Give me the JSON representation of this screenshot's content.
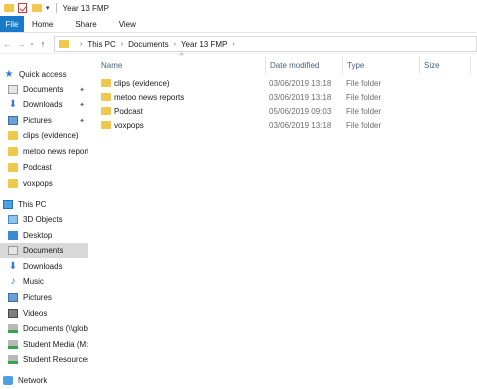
{
  "window": {
    "title": "Year 13 FMP",
    "qa_dropdown": "▾"
  },
  "ribbon": {
    "tabs": [
      "File",
      "Home",
      "Share",
      "View"
    ]
  },
  "nav": {
    "back": "←",
    "forward": "→",
    "recent": "⌄",
    "up": "↑",
    "breadcrumb": [
      "This PC",
      "Documents",
      "Year 13 FMP"
    ],
    "crumb_separator": "›"
  },
  "sidebar": {
    "items": [
      {
        "label": "Quick access",
        "icon": "star-icon"
      },
      {
        "label": "Documents",
        "icon": "documents-icon",
        "pinned": true
      },
      {
        "label": "Downloads",
        "icon": "downloads-icon",
        "pinned": true
      },
      {
        "label": "Pictures",
        "icon": "pictures-icon",
        "pinned": true
      },
      {
        "label": "clips (evidence)",
        "icon": "folder-icon"
      },
      {
        "label": "metoo news reports",
        "icon": "folder-icon"
      },
      {
        "label": "Podcast",
        "icon": "folder-icon"
      },
      {
        "label": "voxpops",
        "icon": "folder-icon"
      },
      {
        "label": "This PC",
        "icon": "this-pc-icon"
      },
      {
        "label": "3D Objects",
        "icon": "3d-objects-icon"
      },
      {
        "label": "Desktop",
        "icon": "desktop-icon"
      },
      {
        "label": "Documents",
        "icon": "documents-icon",
        "selected": true
      },
      {
        "label": "Downloads",
        "icon": "downloads-icon"
      },
      {
        "label": "Music",
        "icon": "music-icon"
      },
      {
        "label": "Pictures",
        "icon": "pictures-icon"
      },
      {
        "label": "Videos",
        "icon": "videos-icon"
      },
      {
        "label": "Documents (\\\\glob",
        "icon": "network-drive-icon"
      },
      {
        "label": "Student Media (M:)",
        "icon": "network-drive-icon"
      },
      {
        "label": "Student Resources (",
        "icon": "network-drive-icon"
      },
      {
        "label": "Network",
        "icon": "network-icon"
      }
    ],
    "pin_glyph": "📌"
  },
  "columns": {
    "name": "Name",
    "date": "Date modified",
    "type": "Type",
    "size": "Size",
    "sort_glyph": "^"
  },
  "files": [
    {
      "name": "clips (evidence)",
      "date": "03/06/2019 13:18",
      "type": "File folder"
    },
    {
      "name": "metoo news reports",
      "date": "03/06/2019 13:18",
      "type": "File folder"
    },
    {
      "name": "Podcast",
      "date": "05/06/2019 09:03",
      "type": "File folder"
    },
    {
      "name": "voxpops",
      "date": "03/06/2019 13:18",
      "type": "File folder"
    }
  ],
  "colors": {
    "file_tab": "#1979ca",
    "folder": "#f0c84f",
    "selected_row": "#d9d9d9",
    "header_text": "#4c607a"
  }
}
